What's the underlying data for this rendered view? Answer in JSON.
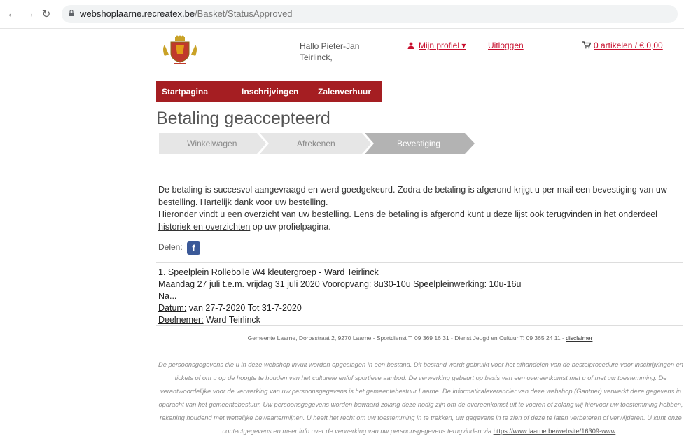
{
  "browser": {
    "url_host": "webshoplaarne.recreatex.be",
    "url_path": "/Basket/StatusApproved"
  },
  "header": {
    "greeting": "Hallo Pieter-Jan Teirlinck,",
    "profile_label": "Mijn profiel ▾",
    "logout_label": "Uitloggen",
    "cart_label": "0 artikelen / € 0,00"
  },
  "menu": [
    "Startpagina",
    "Inschrijvingen",
    "Zalenverhuur"
  ],
  "page_title": "Betaling geaccepteerd",
  "steps": [
    {
      "label": "Winkelwagen",
      "active": false
    },
    {
      "label": "Afrekenen",
      "active": false
    },
    {
      "label": "Bevestiging",
      "active": true
    }
  ],
  "message": {
    "line1": "De betaling is succesvol aangevraagd en werd goedgekeurd. Zodra de betaling is afgerond krijgt u per mail een bevestiging van uw bestelling. Hartelijk dank voor uw bestelling.",
    "line2_prefix": "Hieronder vindt u een overzicht van uw bestelling. Eens de betaling is afgerond kunt u deze lijst ook terugvinden in het onderdeel ",
    "link": "historiek en overzichten",
    "line2_suffix": " op uw profielpagina."
  },
  "share_label": "Delen:",
  "order": {
    "title": "1. Speelplein Rollebolle W4 kleutergroep - Ward Teirlinck",
    "description": "Maandag 27 juli t.e.m. vrijdag 31 juli 2020 Vooropvang: 8u30-10u Speelpleinwerking: 10u-16u Na...",
    "date_label": "Datum:",
    "date_value": " van 27-7-2020 Tot 31-7-2020",
    "participant_label": "Deelnemer:",
    "participant_value": " Ward Teirlinck"
  },
  "footer": {
    "contact": "Gemeente Laarne, Dorpsstraat 2, 9270 Laarne - Sportdienst T: 09 369 16 31 - Dienst Jeugd en Cultuur T: 09 365 24 11 - ",
    "disclaimer": "disclaimer",
    "privacy": "De persoonsgegevens die u in deze webshop invult worden opgeslagen in een bestand. Dit bestand wordt gebruikt voor het afhandelen van de bestelprocedure voor inschrijvingen en tickets of om u op de hoogte te houden van het culturele en/of sportieve aanbod. De verwerking gebeurt op basis van een overeenkomst met u of met uw toestemming. De verantwoordelijke voor de verwerking van uw persoonsgegevens is het gemeentebestuur Laarne. De informaticaleverancier van deze webshop (Gantner) verwerkt deze gegevens in opdracht van het gemeentebestuur. Uw persoonsgegevens worden bewaard zolang deze nodig zijn om de overeenkomst uit te voeren of zolang wij hiervoor uw toestemming hebben, rekening houdend met wettelijke bewaartermijnen. U heeft het recht om uw toestemming in te trekken, uw gegevens in te zien of deze te laten verbeteren of verwijderen. U kunt onze contactgegevens en meer info over de verwerking van uw persoonsgegevens terugvinden via ",
    "privacy_link": "https://www.laarne.be/website/16309-www",
    "privacy_end": " ."
  },
  "colors": {
    "brand_red": "#a51e22",
    "link_red": "#c8102e",
    "step_inactive": "#e6e6e6",
    "step_active": "#b3b3b3"
  },
  "icons": [
    "back-arrow-icon",
    "forward-arrow-icon",
    "reload-icon",
    "lock-icon",
    "user-icon",
    "cart-icon",
    "facebook-icon",
    "coat-of-arms-logo"
  ]
}
